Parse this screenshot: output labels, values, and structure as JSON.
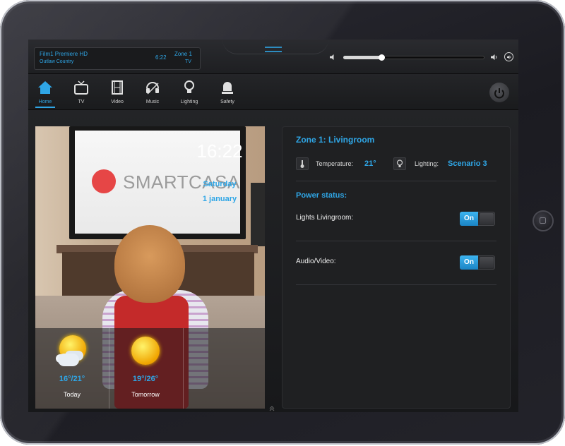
{
  "now_playing": {
    "title": "Film1 Premiere HD",
    "subtitle": "Outlaw Country",
    "time": "6:22",
    "zone": "Zone 1",
    "zone_source": "TV"
  },
  "volume": {
    "level": 0.27
  },
  "nav": {
    "items": [
      {
        "label": "Home",
        "icon": "home-icon",
        "active": true
      },
      {
        "label": "TV",
        "icon": "tv-icon",
        "active": false
      },
      {
        "label": "Video",
        "icon": "film-icon",
        "active": false
      },
      {
        "label": "Music",
        "icon": "music-icon",
        "active": false
      },
      {
        "label": "Lighting",
        "icon": "bulb-icon",
        "active": false
      },
      {
        "label": "Safety",
        "icon": "alarm-icon",
        "active": false
      }
    ]
  },
  "photo": {
    "brand": "SMARTCASA"
  },
  "weather": [
    {
      "range": "16°/21°",
      "day": "Today",
      "icon": "sun-cloud-icon"
    },
    {
      "range": "19°/26°",
      "day": "Tomorrow",
      "icon": "sun-icon"
    }
  ],
  "clock": {
    "time": "16:22",
    "weekday": "Saturday",
    "date": "1 january"
  },
  "zone": {
    "title": "Zone 1: Livingroom",
    "temperature_label": "Temperature:",
    "temperature_value": "21°",
    "lighting_label": "Lighting:",
    "lighting_value": "Scenario 3",
    "power_title": "Power status:",
    "devices": [
      {
        "label": "Lights Livingroom:",
        "state": "On"
      },
      {
        "label": "Audio/Video:",
        "state": "On"
      }
    ]
  },
  "colors": {
    "accent": "#2fa6e6",
    "panel": "#1f2022",
    "background": "#141416"
  }
}
